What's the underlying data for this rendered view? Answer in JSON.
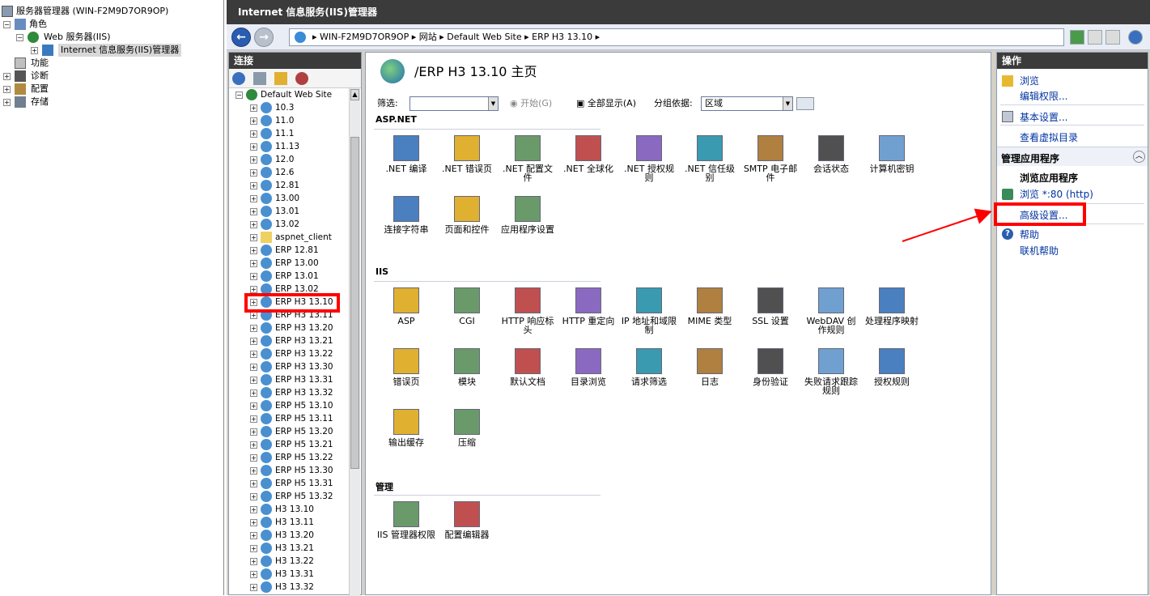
{
  "left_tree": {
    "root": "服务器管理器 (WIN-F2M9D7OR9OP)",
    "roles": "角色",
    "web_server": "Web 服务器(IIS)",
    "iis_manager": "Internet 信息服务(IIS)管理器",
    "features": "功能",
    "diagnostics": "诊断",
    "configuration": "配置",
    "storage": "存储"
  },
  "window": {
    "title": "Internet 信息服务(IIS)管理器"
  },
  "address": {
    "crumbs": [
      "WIN-F2M9D7OR9OP",
      "网站",
      "Default Web Site",
      "ERP H3 13.10"
    ]
  },
  "connections": {
    "title": "连接",
    "site": "Default Web Site",
    "items": [
      "10.3",
      "11.0",
      "11.1",
      "11.13",
      "12.0",
      "12.6",
      "12.81",
      "13.00",
      "13.01",
      "13.02",
      "aspnet_client",
      "ERP 12.81",
      "ERP 13.00",
      "ERP 13.01",
      "ERP 13.02",
      "ERP H3 13.10",
      "ERP H3 13.11",
      "ERP H3 13.20",
      "ERP H3 13.21",
      "ERP H3 13.22",
      "ERP H3 13.30",
      "ERP H3 13.31",
      "ERP H3 13.32",
      "ERP H5 13.10",
      "ERP H5 13.11",
      "ERP H5 13.20",
      "ERP H5 13.21",
      "ERP H5 13.22",
      "ERP H5 13.30",
      "ERP H5 13.31",
      "ERP H5 13.32",
      "H3 13.10",
      "H3 13.11",
      "H3 13.20",
      "H3 13.21",
      "H3 13.22",
      "H3 13.31",
      "H3 13.32"
    ]
  },
  "main": {
    "title": "/ERP H3 13.10 主页",
    "filter_label": "筛选:",
    "start_label": "开始(G)",
    "show_all_label": "全部显示(A)",
    "group_by_label": "分组依据:",
    "group_by_value": "区域",
    "sections": [
      {
        "title": "ASP.NET",
        "items": [
          ".NET 编译",
          ".NET 错误页",
          ".NET 配置文件",
          ".NET 全球化",
          ".NET 授权规则",
          ".NET 信任级别",
          "SMTP 电子邮件",
          "会话状态",
          "计算机密钥",
          "连接字符串",
          "页面和控件",
          "应用程序设置"
        ]
      },
      {
        "title": "IIS",
        "items": [
          "ASP",
          "CGI",
          "HTTP 响应标头",
          "HTTP 重定向",
          "IP 地址和域限制",
          "MIME 类型",
          "SSL 设置",
          "WebDAV 创作规则",
          "处理程序映射",
          "错误页",
          "模块",
          "默认文档",
          "目录浏览",
          "请求筛选",
          "日志",
          "身份验证",
          "失败请求跟踪规则",
          "授权规则",
          "输出缓存",
          "压缩"
        ]
      },
      {
        "title": "管理",
        "items": [
          "IIS 管理器权限",
          "配置编辑器"
        ]
      }
    ]
  },
  "actions": {
    "title": "操作",
    "browse": "浏览",
    "edit_permissions": "编辑权限...",
    "basic_settings": "基本设置...",
    "view_vdirs": "查看虚拟目录",
    "manage_app_title": "管理应用程序",
    "browse_app_title": "浏览应用程序",
    "browse_80": "浏览 *:80 (http)",
    "advanced_settings": "高级设置...",
    "help": "帮助",
    "online_help": "联机帮助"
  },
  "colors": {
    "title_bar": "#3b3b3b",
    "link": "#0033a0",
    "annotation": "#ff0000"
  }
}
